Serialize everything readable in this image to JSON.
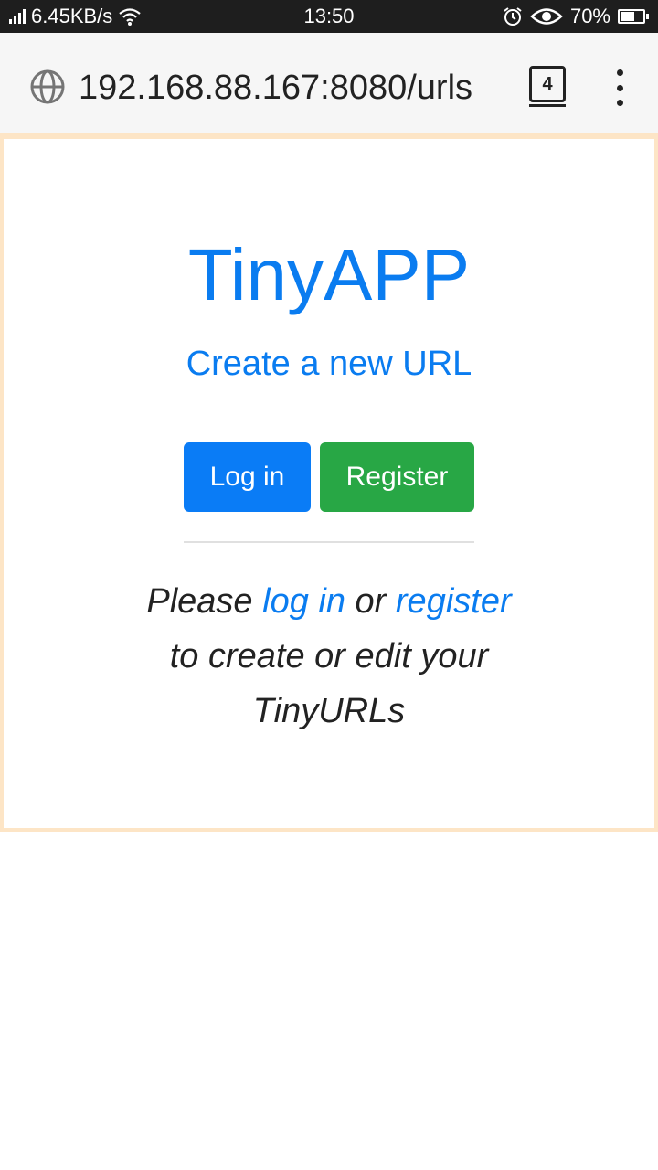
{
  "status_bar": {
    "network_speed": "6.45KB/s",
    "time": "13:50",
    "battery_percent": "70%",
    "battery_level": 0.7,
    "icons": [
      "signal-icon",
      "wifi-icon",
      "alarm-icon",
      "eye-icon",
      "battery-icon"
    ]
  },
  "browser": {
    "url": "192.168.88.167:8080/urls",
    "tab_count": "4",
    "icons": [
      "globe-icon",
      "tabs-icon",
      "more-menu-icon"
    ]
  },
  "page": {
    "title": "TinyAPP",
    "create_link": "Create a new URL",
    "login_button": "Log in",
    "register_button": "Register",
    "message": {
      "please": "Please",
      "login_link": "log in",
      "or": "or",
      "register_link": "register",
      "line2": "to create or edit your",
      "line3": "TinyURLs"
    }
  },
  "colors": {
    "brand_blue": "#0a7cf0",
    "register_green": "#28a745",
    "frame_border": "#fde5c6"
  }
}
